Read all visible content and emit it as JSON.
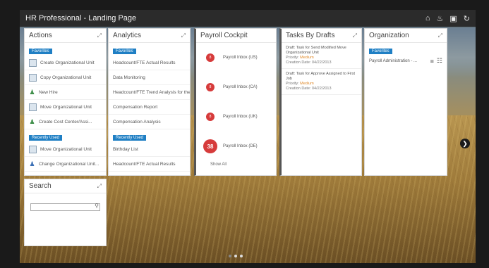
{
  "window": {
    "title": "HR Professional - Landing Page",
    "icons": [
      "home-icon",
      "bell-icon",
      "save-icon",
      "refresh-icon"
    ]
  },
  "actions": {
    "title": "Actions",
    "section1_tag": "Favorites",
    "section1_items": [
      {
        "label": "Create Organizational Unit",
        "icon": "org-unit-icon"
      },
      {
        "label": "Copy Organizational Unit",
        "icon": "org-unit-icon"
      },
      {
        "label": "New Hire",
        "icon": "person-icon"
      },
      {
        "label": "Move Organizational Unit",
        "icon": "org-unit-icon"
      },
      {
        "label": "Create Cost Center/Assi...",
        "icon": "person-icon"
      }
    ],
    "section2_tag": "Recently Used",
    "section2_items": [
      {
        "label": "Move Organizational Unit",
        "icon": "org-unit-icon"
      },
      {
        "label": "Change Organizational Unit...",
        "icon": "person-icon"
      }
    ]
  },
  "analytics": {
    "title": "Analytics",
    "section1_tag": "Favorites",
    "section1_items": [
      "Headcount/FTE Actual Results",
      "Data Monitoring",
      "Headcount/FTE Trend Analysis for the",
      "Compensation Report",
      "Compensation Analysis"
    ],
    "section2_tag": "Recently Used",
    "section2_items": [
      "Birthday List",
      "Headcount/FTE Actual Results"
    ]
  },
  "payroll": {
    "title": "Payroll Cockpit",
    "items": [
      {
        "count": "8",
        "label": "Payroll Inbox (US)"
      },
      {
        "count": "8",
        "label": "Payroll Inbox (CA)"
      },
      {
        "count": "8",
        "label": "Payroll Inbox (UK)"
      },
      {
        "count": "38",
        "label": "Payroll Inbox (DE)"
      }
    ],
    "show_all": "Show All"
  },
  "drafts": {
    "title": "Tasks By Drafts",
    "items": [
      {
        "title": "Draft: Task for Send Modified Move Organizational Unit",
        "priority_label": "Priority:",
        "priority": "Medium",
        "created": "Creation Date: 04/22/2013"
      },
      {
        "title": "Draft: Task for Approve Assigned to First Job",
        "priority_label": "Priority:",
        "priority": "Medium",
        "created": "Creation Date: 04/22/2013"
      }
    ]
  },
  "organization": {
    "title": "Organization",
    "tag": "Favorites",
    "item": "Payroll Administration - ..."
  },
  "search": {
    "title": "Search",
    "placeholder": ""
  }
}
